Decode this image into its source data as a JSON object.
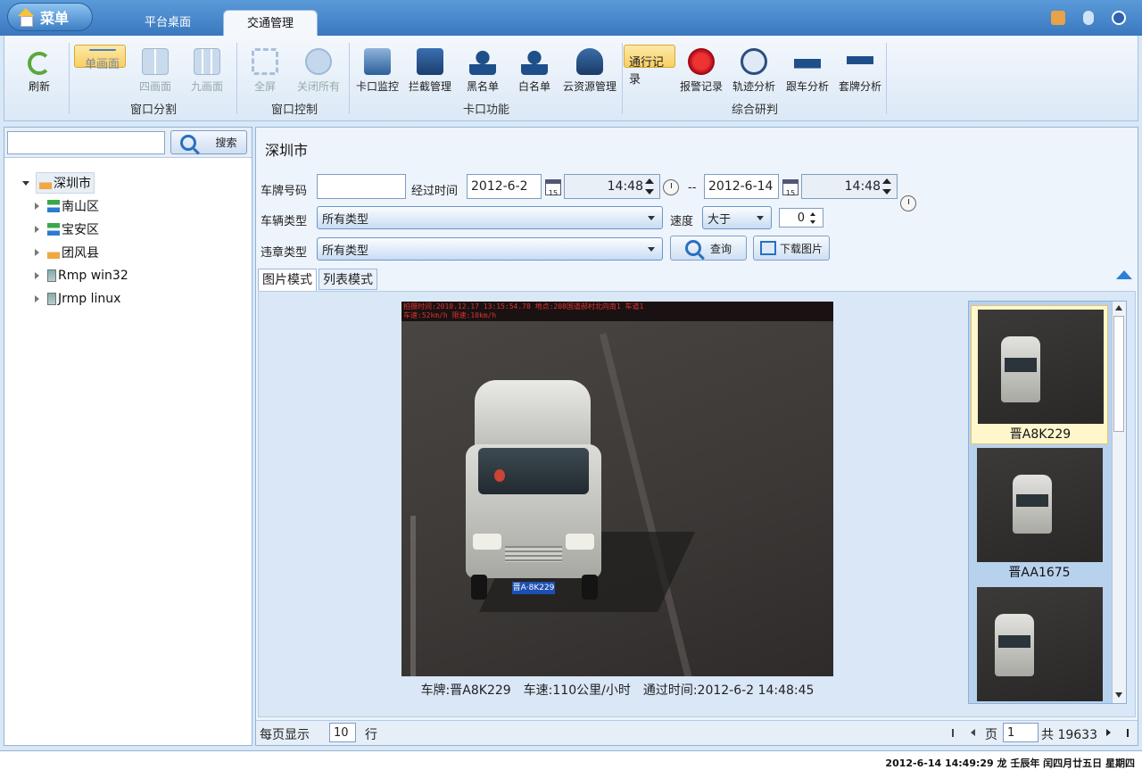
{
  "header": {
    "menu_label": "菜单",
    "tabs": [
      {
        "label": "平台桌面",
        "active": false
      },
      {
        "label": "交通管理",
        "active": true
      }
    ]
  },
  "ribbon": {
    "refresh": "刷新",
    "window_split": {
      "group": "窗口分割",
      "items": [
        "单画面",
        "四画面",
        "九画面"
      ]
    },
    "window_control": {
      "group": "窗口控制",
      "items": [
        "全屏",
        "关闭所有"
      ]
    },
    "checkpoint": {
      "group": "卡口功能",
      "items": [
        "卡口监控",
        "拦截管理",
        "黑名单",
        "白名单",
        "云资源管理"
      ]
    },
    "analysis": {
      "group": "综合研判",
      "items": [
        "通行记录",
        "报警记录",
        "轨迹分析",
        "跟车分析",
        "套牌分析"
      ]
    }
  },
  "sidebar": {
    "search_placeholder": "",
    "search_label": "搜索",
    "tree": [
      {
        "label": "深圳市",
        "icon": "home-icon",
        "level": 0
      },
      {
        "label": "南山区",
        "icon": "network-icon",
        "level": 1
      },
      {
        "label": "宝安区",
        "icon": "network-icon",
        "level": 1
      },
      {
        "label": "团风县",
        "icon": "home-icon",
        "level": 1
      },
      {
        "label": "Rmp win32",
        "icon": "server-icon",
        "level": 1
      },
      {
        "label": "Jrmp linux",
        "icon": "server-icon",
        "level": 1
      }
    ]
  },
  "filter": {
    "city": "深圳市",
    "plate_label": "车牌号码",
    "plate_value": "",
    "time_label": "经过时间",
    "start_date": "2012-6-2",
    "start_time": "14:48",
    "range_sep": "--",
    "end_date": "2012-6-14",
    "end_time": "14:48",
    "vehicle_type_label": "车辆类型",
    "vehicle_type": "所有类型",
    "speed_label": "速度",
    "speed_op": "大于",
    "speed_value": "0",
    "violation_label": "违章类型",
    "violation_type": "所有类型",
    "query_label": "查询",
    "download_label": "下载图片"
  },
  "view_tabs": [
    "图片模式",
    "列表模式"
  ],
  "image": {
    "overlay_line1": "拍摄时间:2010.12.17 13:15:54.78 地点:208国道郝村北向南1 车道1",
    "overlay_line2": "车速:52km/h 限速:10km/h",
    "plate_on_car": "晋A·8K229",
    "caption": "车牌:晋A8K229　车速:110公里/小时　通过时间:2012-6-2 14:48:45"
  },
  "thumbnails": [
    {
      "label": "晋A8K229",
      "selected": true
    },
    {
      "label": "晋AA1675",
      "selected": false
    },
    {
      "label": "",
      "selected": false
    }
  ],
  "pager": {
    "per_page_label": "每页显示",
    "per_page": "10",
    "rows_label": "行",
    "page_label": "页",
    "page": "1",
    "total_label": "共 19633"
  },
  "status": "2012-6-14 14:49:29 龙 壬辰年 闰四月廿五日 星期四"
}
